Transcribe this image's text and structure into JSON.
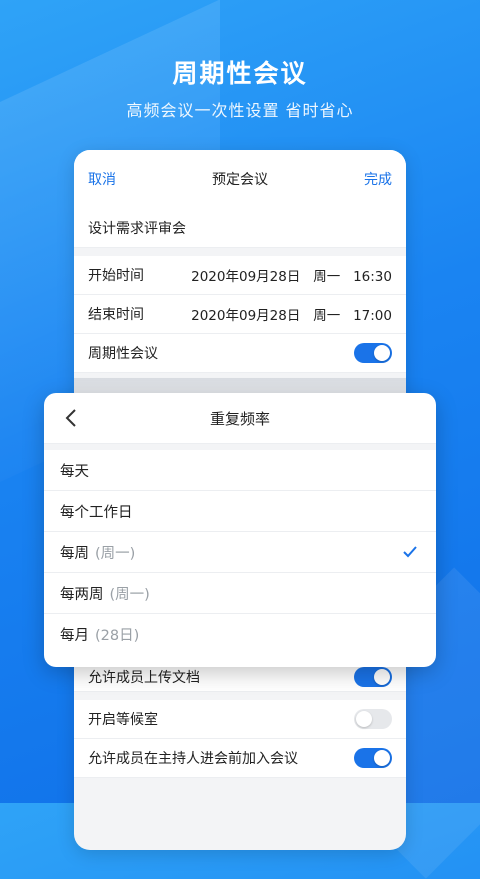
{
  "hero": {
    "title": "周期性会议",
    "subtitle": "高频会议一次性设置 省时省心"
  },
  "nav": {
    "cancel": "取消",
    "title": "预定会议",
    "done": "完成"
  },
  "form": {
    "topic": "设计需求评审会",
    "start_label": "开始时间",
    "start_value": "2020年09月28日   周一   16:30",
    "end_label": "结束时间",
    "end_value": "2020年09月28日   周一   17:00",
    "recurring_label": "周期性会议",
    "recurring_on": true,
    "upload_label": "允许成员上传文档",
    "upload_on": true,
    "waiting_label": "开启等候室",
    "waiting_on": false,
    "join_before_label": "允许成员在主持人进会前加入会议",
    "join_before_on": true
  },
  "modal": {
    "title": "重复频率",
    "options": [
      {
        "label": "每天",
        "sub": ""
      },
      {
        "label": "每个工作日",
        "sub": ""
      },
      {
        "label": "每周",
        "sub": "(周一)",
        "selected": true
      },
      {
        "label": "每两周",
        "sub": "(周一)"
      },
      {
        "label": "每月",
        "sub": "(28日)"
      }
    ]
  },
  "colors": {
    "accent": "#1a73e8",
    "background": "#1a84f2"
  }
}
